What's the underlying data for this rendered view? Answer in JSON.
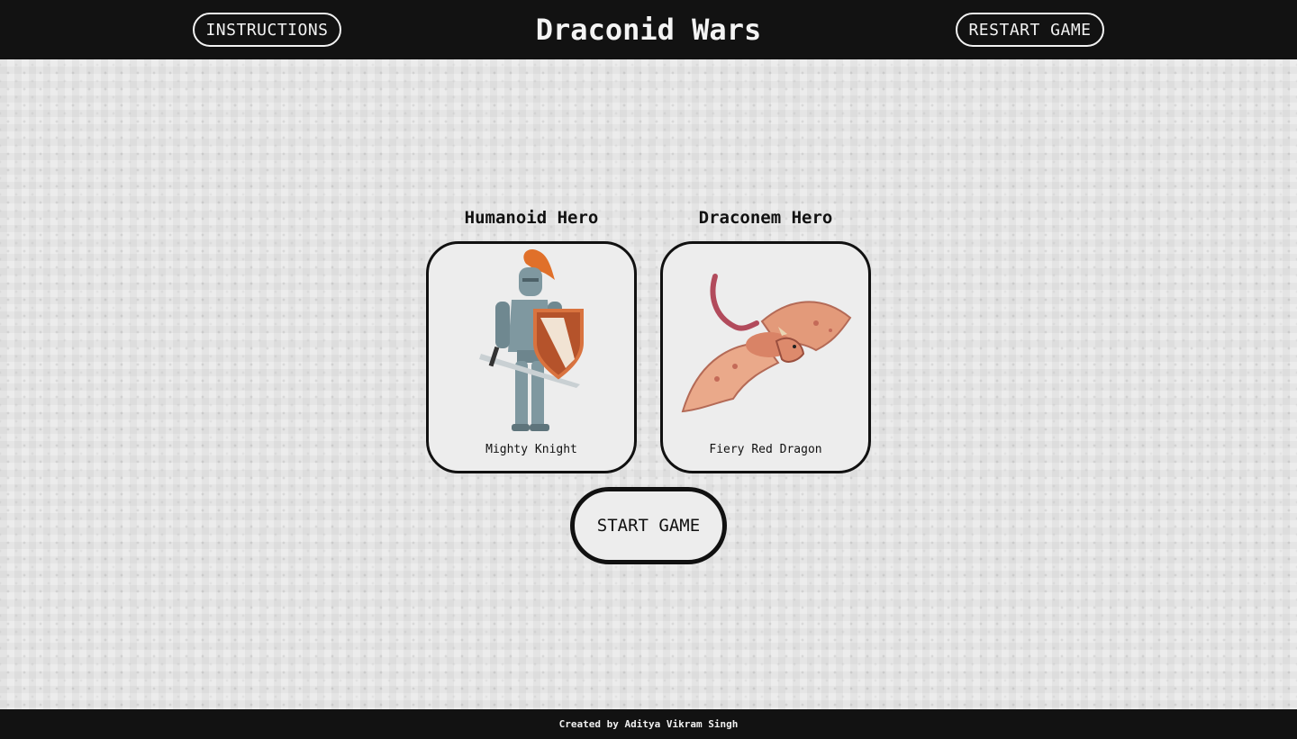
{
  "header": {
    "title": "Draconid Wars",
    "instructions_label": "INSTRUCTIONS",
    "restart_label": "RESTART GAME"
  },
  "heroes": [
    {
      "heading": "Humanoid Hero",
      "name": "Mighty Knight",
      "icon": "knight-icon"
    },
    {
      "heading": "Draconem Hero",
      "name": "Fiery Red Dragon",
      "icon": "dragon-icon"
    }
  ],
  "start_label": "START GAME",
  "footer": {
    "credit": "Created by Aditya Vikram Singh"
  },
  "colors": {
    "header_bg": "#121212",
    "page_bg": "#ececec",
    "card_border": "#111111",
    "knight_armor": "#7f98a0",
    "knight_plume": "#e0702a",
    "shield": "#b5532b",
    "dragon": "#e39a7a"
  }
}
